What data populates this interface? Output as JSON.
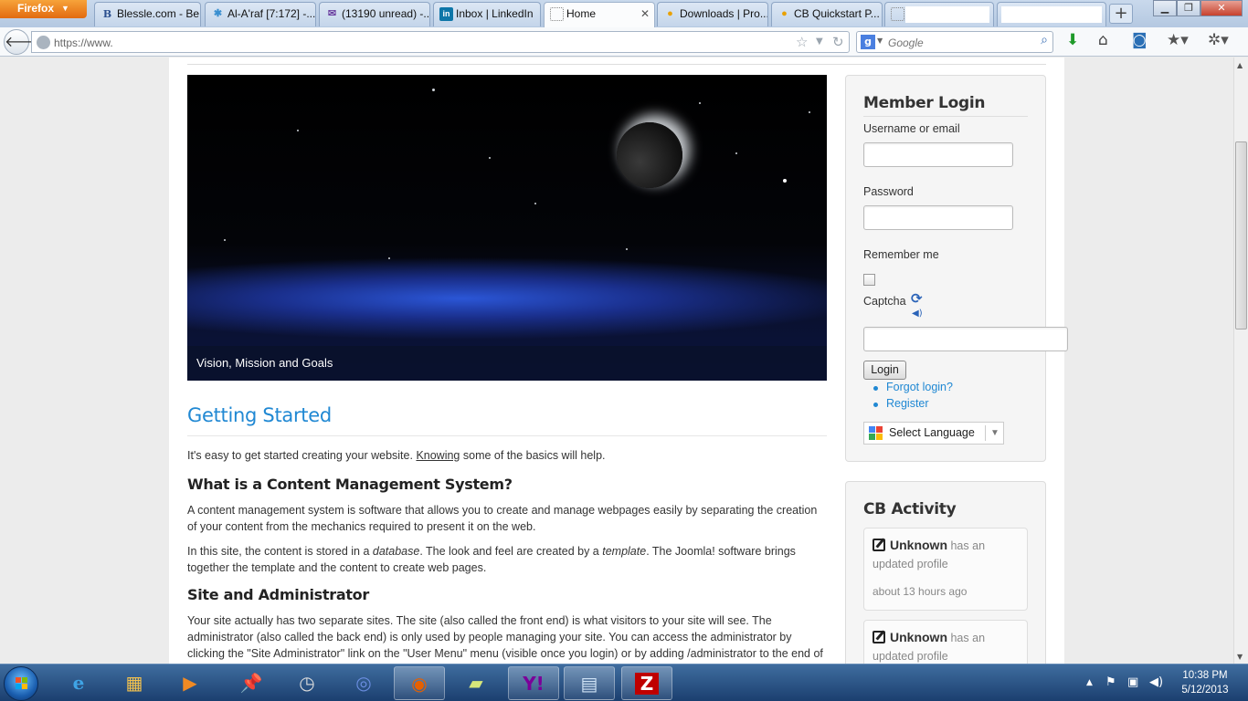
{
  "browser": {
    "menu_label": "Firefox",
    "tabs": [
      {
        "title": "Blessle.com - Be...",
        "icon": "B"
      },
      {
        "title": "Al-A'raf [7:172] -...",
        "icon": "✱"
      },
      {
        "title": "(13190 unread) -...",
        "icon": "✉"
      },
      {
        "title": "Inbox | LinkedIn",
        "icon": "in"
      },
      {
        "title": "Home",
        "icon": ""
      },
      {
        "title": "Downloads | Pro...",
        "icon": "●"
      },
      {
        "title": "CB Quickstart P...",
        "icon": "●"
      },
      {
        "title": "",
        "icon": ""
      },
      {
        "title": "",
        "icon": ""
      }
    ],
    "new_tab_symbol": "+",
    "url": "https://www.",
    "search_engine": "g",
    "search_placeholder": "Google"
  },
  "hero": {
    "caption": "Vision, Mission and Goals"
  },
  "article": {
    "title": "Getting Started",
    "intro_before": "It's easy to get started creating your website. ",
    "intro_link": "Knowing",
    "intro_after": " some of the basics will help.",
    "h_cms": "What is a Content Management System?",
    "p_cms_1": "A content management system is software that allows you to create and manage webpages easily by separating the creation of your content from the mechanics required to present it on the web.",
    "p_cms_2_a": "In this site, the content is stored in a ",
    "p_cms_2_b": "database",
    "p_cms_2_c": ". The look and feel are created by a ",
    "p_cms_2_d": "template",
    "p_cms_2_e": ". The Joomla! software brings together the template and the content to create web pages.",
    "h_site": "Site and Administrator",
    "p_site": "Your site actually has two separate sites. The site (also called the front end) is what visitors to your site will see. The administrator (also called the back end) is only used by people managing your site. You can access the administrator by clicking the \"Site Administrator\" link on the \"User Menu\" menu (visible once you login) or by adding /administrator to the end of your domain name."
  },
  "login": {
    "title": "Member Login",
    "username_label": "Username or email",
    "password_label": "Password",
    "remember_label": "Remember me",
    "captcha_label": "Captcha",
    "login_button": "Login",
    "forgot_link": "Forgot login?",
    "register_link": "Register",
    "language_select": "Select Language"
  },
  "cb_activity": {
    "title": "CB Activity",
    "items": [
      {
        "user": "Unknown",
        "action_1": "has an",
        "action_2": "updated profile",
        "time": "about 13 hours ago"
      },
      {
        "user": "Unknown",
        "action_1": "has an",
        "action_2": "updated profile"
      }
    ]
  },
  "taskbar": {
    "time": "10:38 PM",
    "date": "5/12/2013"
  },
  "colors": {
    "link_blue": "#2088d3",
    "taskbar": "#1b3f6f",
    "firefox_orange": "#e26b10"
  }
}
